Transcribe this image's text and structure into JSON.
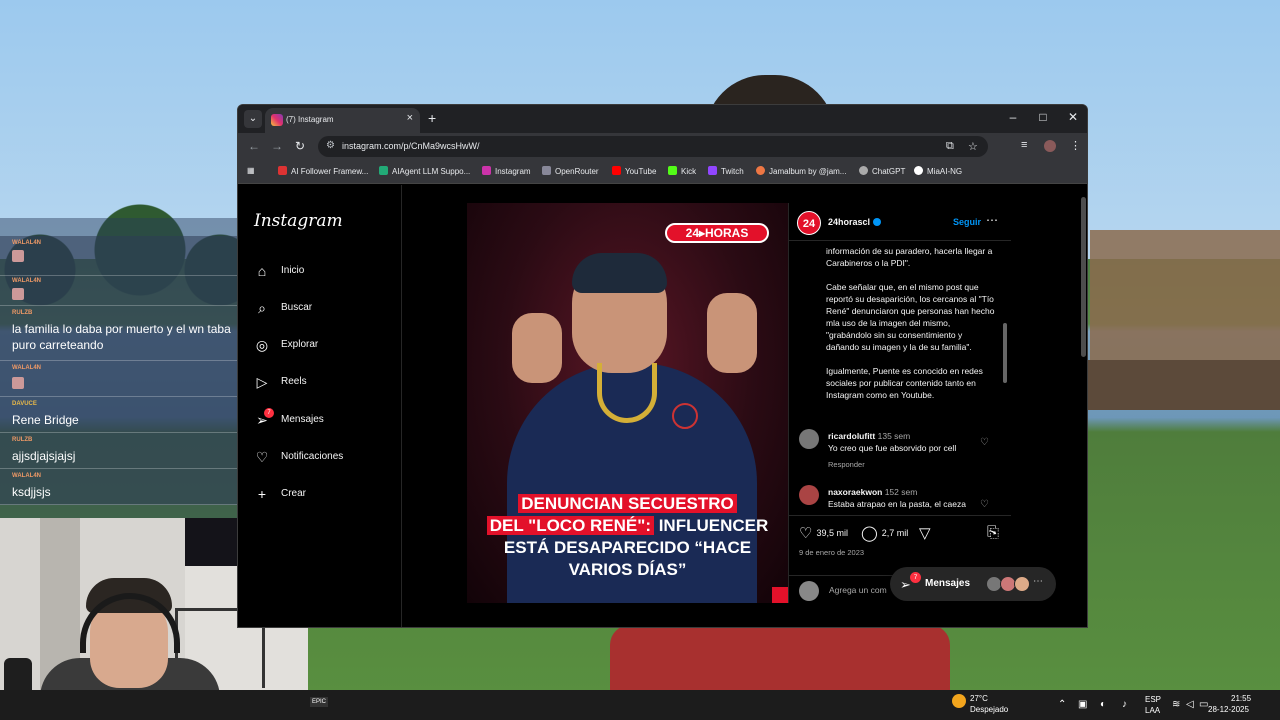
{
  "browser": {
    "tab_title": "(7) Instagram",
    "url": "instagram.com/p/CnMa9wcsHwW/",
    "bookmarks": [
      "AI Follower Framew...",
      "AIAgent LLM Suppo...",
      "Instagram",
      "OpenRouter",
      "YouTube",
      "Kick",
      "Twitch",
      "Jamalbum by @jam...",
      "ChatGPT",
      "MiaAI-NG"
    ]
  },
  "instagram": {
    "logo": "Instagram",
    "nav": [
      {
        "label": "Inicio",
        "icon": "home-icon"
      },
      {
        "label": "Buscar",
        "icon": "search-icon"
      },
      {
        "label": "Explorar",
        "icon": "compass-icon"
      },
      {
        "label": "Reels",
        "icon": "reels-icon"
      },
      {
        "label": "Mensajes",
        "icon": "messenger-icon",
        "badge": "7"
      },
      {
        "label": "Notificaciones",
        "icon": "heart-icon"
      },
      {
        "label": "Crear",
        "icon": "plus-icon"
      }
    ],
    "post": {
      "image_logo": "24▸HORAS",
      "headline_red_1": "DENUNCIAN SECUESTRO",
      "headline_red_2": "DEL \"LOCO RENÉ\":",
      "headline_white_1": " INFLUENCER",
      "headline_white_2": "ESTÁ DESAPARECIDO “HACE VARIOS DÍAS”",
      "avatar_text": "24",
      "username": "24horascl",
      "follow": "Seguir",
      "caption": [
        "información de su paradero, hacerla llegar a Carabineros o la PDI\".",
        "Cabe señalar que, en el mismo post que reportó su desaparición, los cercanos al \"Tío René\" denunciaron que personas han hecho mla uso de la imagen del mismo, \"grabándolo sin su consentimiento y dañando su imagen y la de su familia\".",
        "Igualmente, Puente es conocido en redes sociales por publicar contenido tanto en Instagram como en Youtube."
      ],
      "comments": [
        {
          "user": "ricardolufitt",
          "time": "135 sem",
          "text": "Yo creo que fue absorvido por cell",
          "reply": "Responder"
        },
        {
          "user": "naxoraekwon",
          "time": "152 sem",
          "text": "Estaba atrapao en la pasta, el caeza"
        }
      ],
      "likes": "39,5 mil",
      "comment_count": "2,7 mil",
      "date": "9 de enero de 2023",
      "add_comment_placeholder": "Agrega un com"
    },
    "messages_pill": {
      "label": "Mensajes",
      "badge": "7"
    }
  },
  "chat": [
    {
      "user": "WALAL4N",
      "text": ""
    },
    {
      "user": "WALAL4N",
      "text": ""
    },
    {
      "user": "RULZB",
      "text": "la familia lo daba por muerto y el wn taba puro carreteando"
    },
    {
      "user": "WALAL4N",
      "text": ""
    },
    {
      "user": "DAVUCE",
      "text": "Rene Bridge"
    },
    {
      "user": "RULZB",
      "text": "ajjsdjajsjajsj"
    },
    {
      "user": "WALAL4N",
      "text": "ksdjjsjs"
    }
  ],
  "taskbar": {
    "temp": "27°C",
    "weather": "Despejado",
    "lang1": "ESP",
    "lang2": "LAA",
    "time": "21:55",
    "date": "28-12-2025"
  }
}
